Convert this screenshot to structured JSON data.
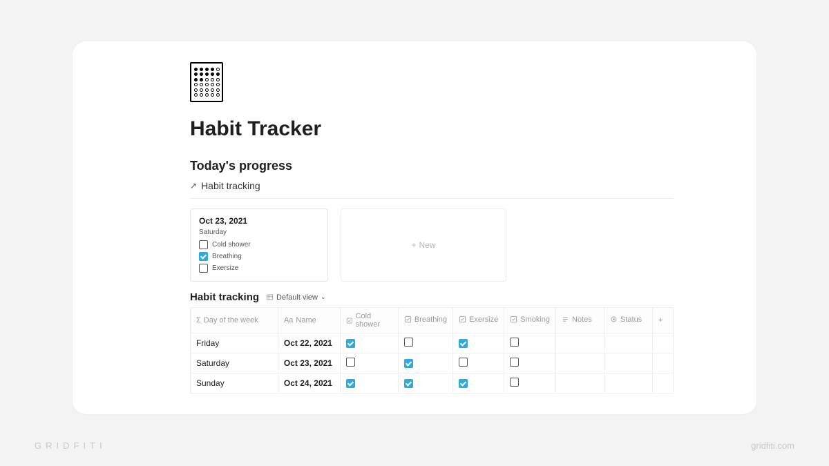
{
  "page": {
    "title": "Habit Tracker"
  },
  "today": {
    "heading": "Today's progress",
    "linked_db_label": "Habit tracking",
    "card": {
      "date": "Oct 23, 2021",
      "day": "Saturday",
      "items": [
        {
          "label": "Cold shower",
          "checked": false
        },
        {
          "label": "Breathing",
          "checked": true
        },
        {
          "label": "Exersize",
          "checked": false
        }
      ]
    },
    "new_label": "New"
  },
  "table": {
    "title": "Habit tracking",
    "view_label": "Default view",
    "columns": {
      "day": "Day of the week",
      "name": "Name",
      "cold_shower": "Cold shower",
      "breathing": "Breathing",
      "exersize": "Exersize",
      "smoking": "Smoking",
      "notes": "Notes",
      "status": "Status"
    },
    "rows": [
      {
        "day": "Friday",
        "name": "Oct 22, 2021",
        "cold_shower": true,
        "breathing": false,
        "exersize": true,
        "smoking": false
      },
      {
        "day": "Saturday",
        "name": "Oct 23, 2021",
        "cold_shower": false,
        "breathing": true,
        "exersize": false,
        "smoking": false
      },
      {
        "day": "Sunday",
        "name": "Oct 24, 2021",
        "cold_shower": true,
        "breathing": true,
        "exersize": true,
        "smoking": false
      }
    ]
  },
  "watermark": {
    "left": "GRIDFITI",
    "right": "gridfiti.com"
  }
}
